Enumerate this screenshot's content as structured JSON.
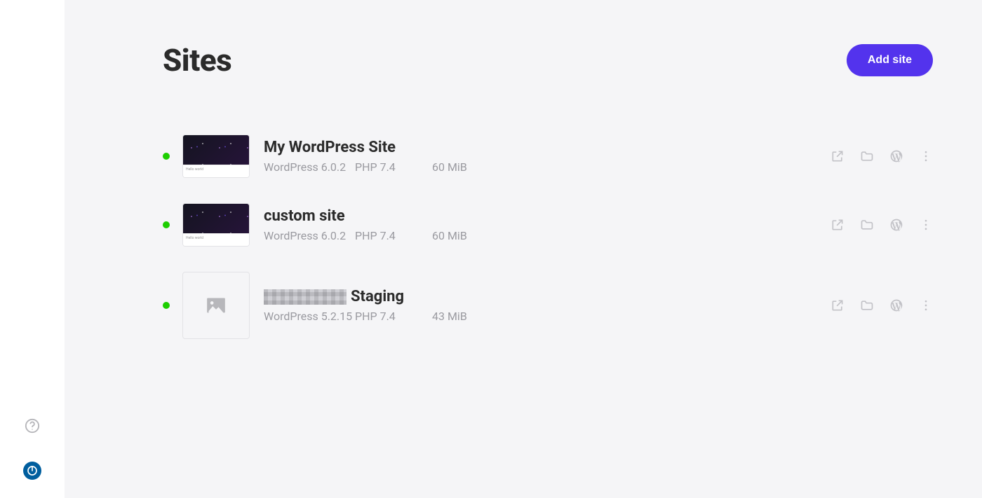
{
  "header": {
    "title": "Sites",
    "add_button": "Add site"
  },
  "sites": [
    {
      "name": "My WordPress Site",
      "redacted_prefix": false,
      "wp_version": "WordPress 6.0.2",
      "php_version": "PHP 7.4",
      "size": "60 MiB",
      "status": "running",
      "thumb": "dark"
    },
    {
      "name": "custom site",
      "redacted_prefix": false,
      "wp_version": "WordPress 6.0.2",
      "php_version": "PHP 7.4",
      "size": "60 MiB",
      "status": "running",
      "thumb": "dark"
    },
    {
      "name": "Staging",
      "redacted_prefix": true,
      "wp_version": "WordPress 5.2.15",
      "php_version": "PHP 7.4",
      "size": "43 MiB",
      "status": "running",
      "thumb": "placeholder"
    }
  ],
  "icons": {
    "open_external": "open-external-icon",
    "folder": "folder-icon",
    "wordpress": "wordpress-icon",
    "more": "more-icon",
    "help": "help-icon",
    "power": "power-icon"
  }
}
